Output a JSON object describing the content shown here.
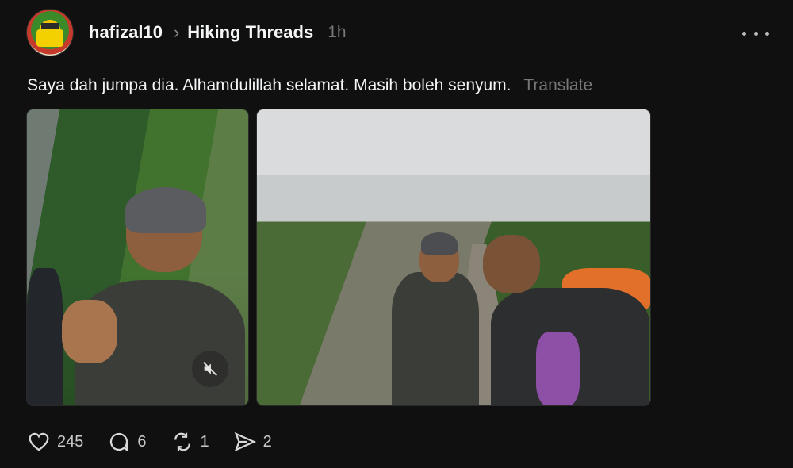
{
  "post": {
    "username": "hafizal10",
    "community": "Hiking Threads",
    "time": "1h",
    "text": "Saya dah jumpa dia. Alhamdulillah selamat. Masih boleh senyum.",
    "translate": "Translate"
  },
  "icons": {
    "more": "more-horizontal-icon",
    "breadcrumb": "chevron-right-icon",
    "mute": "speaker-muted-icon",
    "like": "heart-icon",
    "reply": "comment-bubble-icon",
    "repost": "repost-icon",
    "share": "send-icon"
  },
  "actions": {
    "likes": "245",
    "replies": "6",
    "reposts": "1",
    "shares": "2"
  }
}
